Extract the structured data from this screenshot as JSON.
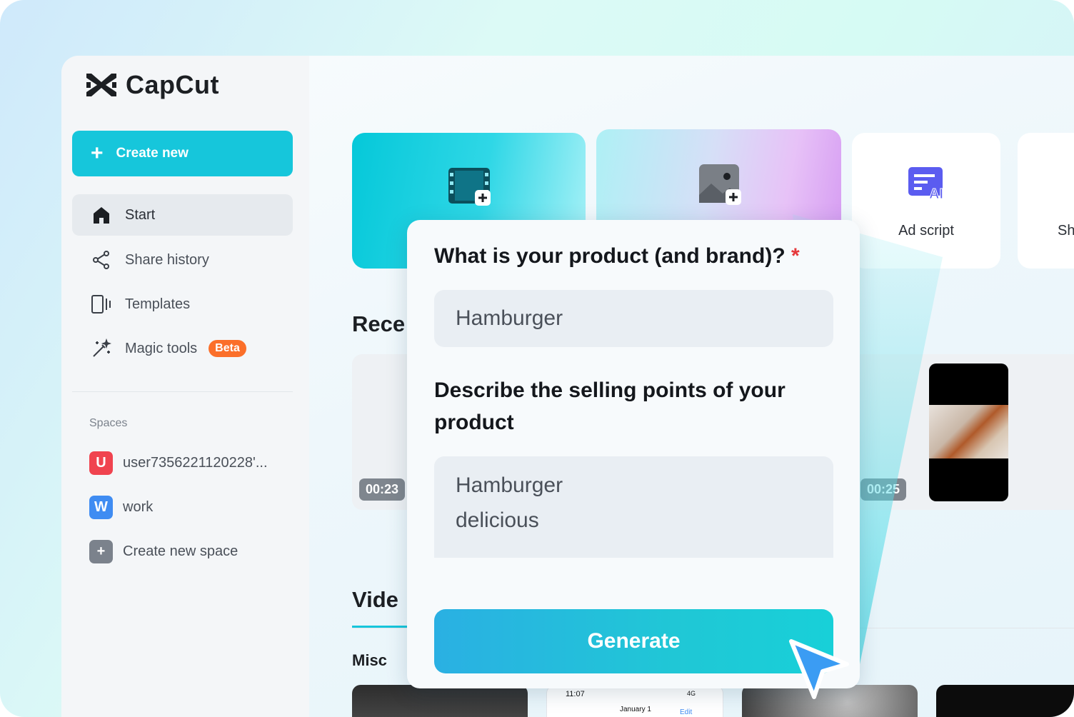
{
  "app": {
    "brand": "CapCut"
  },
  "sidebar": {
    "create_new": "Create new",
    "nav": [
      {
        "label": "Start",
        "icon": "home-icon",
        "active": true
      },
      {
        "label": "Share history",
        "icon": "share-icon"
      },
      {
        "label": "Templates",
        "icon": "templates-icon"
      },
      {
        "label": "Magic tools",
        "icon": "magic-wand-icon",
        "badge": "Beta"
      }
    ],
    "spaces_label": "Spaces",
    "spaces": [
      {
        "badge": "U",
        "label": "user7356221120228'...",
        "color": "#f0434f"
      },
      {
        "badge": "W",
        "label": "work",
        "color": "#3f8cf2"
      },
      {
        "badge": "+",
        "label": "Create new space",
        "color": "#7b828c"
      }
    ]
  },
  "main": {
    "cards": [
      {
        "label": "",
        "icon": "new-video-icon"
      },
      {
        "label": "",
        "icon": "new-image-icon"
      },
      {
        "label": "Ad script",
        "icon": "ad-script-ai-icon"
      },
      {
        "label": "Sh",
        "icon": ""
      }
    ],
    "recent_title": "Rece",
    "recent_times": [
      "00:23",
      "00:25"
    ],
    "videos_title": "Vide",
    "misc_label": "Misc",
    "phone_time": "11:07",
    "phone_signal": "4G",
    "phone_date": "January 1",
    "phone_edit": "Edit"
  },
  "popup": {
    "q1": "What is your product (and brand)?",
    "q1_required": "*",
    "q1_value": "Hamburger",
    "q2_line1": "Describe the selling points of your",
    "q2_line2": "product",
    "q2_value_line1": "Hamburger",
    "q2_value_line2": "delicious",
    "generate": "Generate"
  },
  "colors": {
    "accent": "#16c6db",
    "beta": "#fb6f2a",
    "required": "#e5383b"
  }
}
